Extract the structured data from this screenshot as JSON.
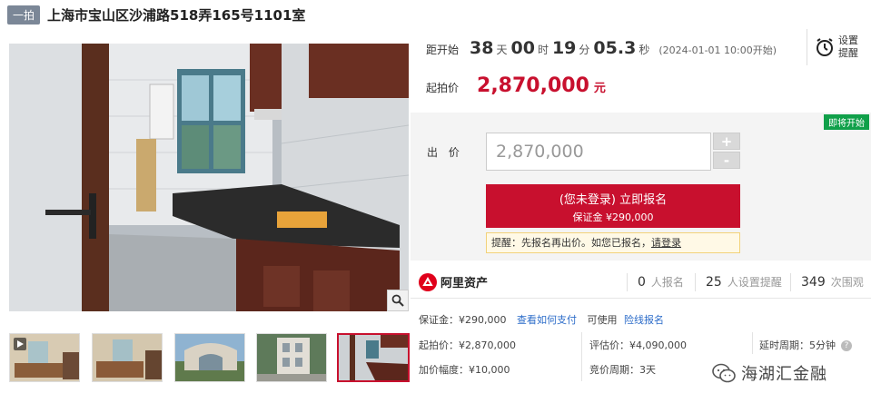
{
  "header": {
    "tag": "一拍",
    "title": "上海市宝山区沙浦路518弄165号1101室"
  },
  "countdown": {
    "label": "距开始",
    "days": "38",
    "days_unit": "天",
    "hours": "00",
    "hours_unit": "时",
    "minutes": "19",
    "minutes_unit": "分",
    "seconds": "05.3",
    "seconds_unit": "秒",
    "start_time": "(2024-01-01 10:00开始)"
  },
  "remind": {
    "line1": "设置",
    "line2": "提醒",
    "icon": "alarm-clock-icon"
  },
  "start_price": {
    "label": "起拍价",
    "value": "2,870,000",
    "unit": "元"
  },
  "bid": {
    "status_badge": "即将开始",
    "label": "出 价",
    "input_value": "2,870,000",
    "plus": "+",
    "minus": "-",
    "signup_main": "(您未登录) 立即报名",
    "signup_sub": "保证金 ¥290,000",
    "tip_text": "提醒：先报名再出价。如您已报名，",
    "tip_login": "请登录"
  },
  "ali": {
    "logo_text": "阿里资产",
    "signed_num": "0",
    "signed_label": "人报名",
    "remind_num": "25",
    "remind_label": "人设置提醒",
    "views_num": "349",
    "views_label": "次围观"
  },
  "deposit": {
    "label": "保证金：¥290,000",
    "link1": "查看如何支付",
    "text": "可使用",
    "link2": "险线报名"
  },
  "details": {
    "start_price": "起拍价：¥2,870,000",
    "appraisal": "评估价：¥4,090,000",
    "delay": "延时周期：5分钟",
    "increment": "加价幅度：¥10,000",
    "auction_cycle": "竞价周期：3天"
  },
  "watermark": {
    "text": "海湖汇金融"
  },
  "colors": {
    "accent": "#c8102e",
    "badge": "#10a04a",
    "link": "#2c6cc9",
    "tag": "#7b8797"
  }
}
